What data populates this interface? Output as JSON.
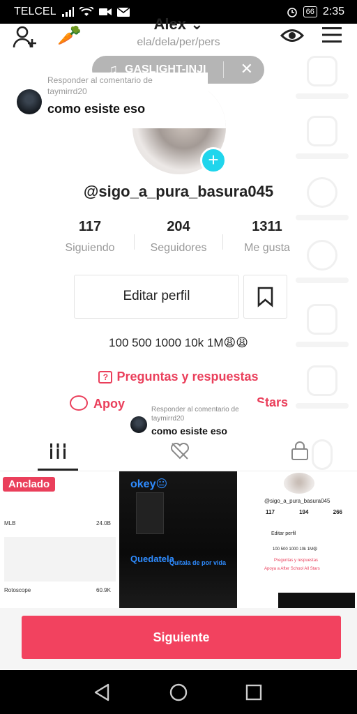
{
  "status_bar": {
    "carrier": "TELCEL",
    "battery": "66",
    "time": "2:35"
  },
  "header": {
    "username": "Alex",
    "pronouns": "ela/dela/per/pers"
  },
  "music": {
    "title": "GASLIGHT-INJI"
  },
  "reply_top": {
    "label": "Responder al comentario de",
    "user": "taymirrd20",
    "text": "como esiste eso"
  },
  "profile": {
    "handle": "@sigo_a_pura_basura045",
    "stats": [
      {
        "value": "117",
        "label": "Siguiendo"
      },
      {
        "value": "204",
        "label": "Seguidores"
      },
      {
        "value": "1311",
        "label": "Me gusta"
      }
    ],
    "edit_label": "Editar perfil",
    "bio": "100 500 1000 10k 1M😩😩",
    "qa_label": "Preguntas y respuestas",
    "support_prefix": "Apoy",
    "support_suffix": "Stars"
  },
  "reply_bottom": {
    "label": "Responder al comentario de",
    "user": "taymirrd20",
    "text": "como esiste eso"
  },
  "grid": {
    "pinned_label": "Anclado",
    "cell1_rows": [
      {
        "name": "MLB",
        "size": "24.0B"
      },
      {
        "name": "Rotoscope",
        "size": "60.9K"
      }
    ],
    "cell2_text1": "okey😐",
    "cell2_text2": "Quedatela",
    "cell2_text3": "Quitala de por vida",
    "cell3_handle": "@sigo_a_pura_basura045",
    "cell3_stats": [
      "117",
      "194",
      "266"
    ],
    "cell3_edit": "Editar perfil",
    "cell3_bio": "100 500 1000 10k 1M😩",
    "cell3_qa": "Preguntas y respuestas",
    "cell3_support": "Apoya a After School All Stars"
  },
  "footer": {
    "next_label": "Siguiente"
  },
  "colors": {
    "accent": "#ea3f5b",
    "button": "#f2425f",
    "plus": "#20d5ec"
  }
}
